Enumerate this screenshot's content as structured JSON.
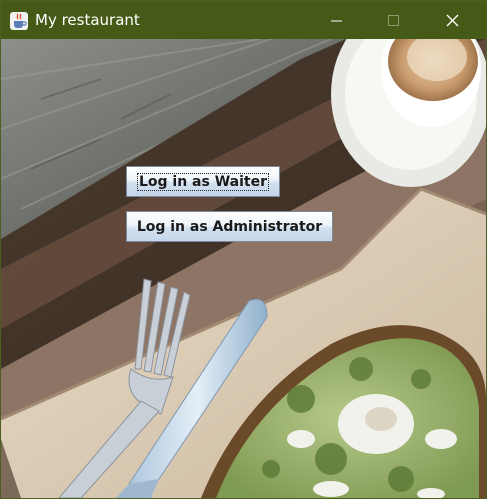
{
  "window": {
    "title": "My restaurant",
    "app_icon": "java-cup-icon",
    "controls": {
      "minimize_icon": "minimize-icon",
      "maximize_icon": "maximize-icon",
      "close_icon": "close-icon"
    }
  },
  "colors": {
    "titlebar": "#455a17",
    "button_top": "#ffffff",
    "button_bottom": "#c4d6ea"
  },
  "actions": {
    "waiter_login": "Log in as Waiter",
    "admin_login": "Log in as Administrator"
  }
}
